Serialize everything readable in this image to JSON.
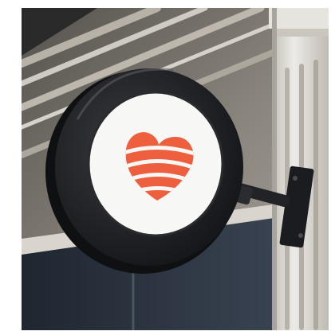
{
  "image": {
    "subject": "round-hanging-storefront-sign",
    "logo_icon": "striped-heart-icon",
    "colors": {
      "logo": "#ee5f3d",
      "sign_face": "#f7f7f5",
      "sign_frame": "#1f2023",
      "building_trim": "#dedbd5",
      "window_glass": "#2c3440"
    }
  }
}
